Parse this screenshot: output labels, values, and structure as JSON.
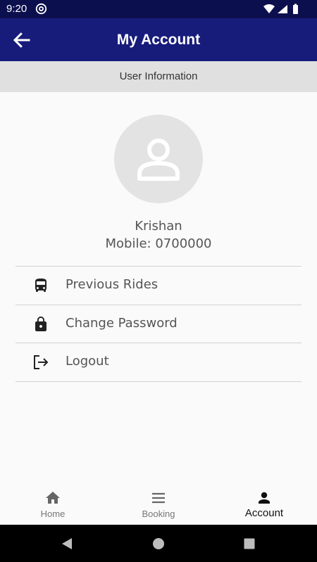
{
  "status_bar": {
    "time": "9:20",
    "app_icon": "at-sign-icon",
    "icons": [
      "wifi-icon",
      "signal-icon",
      "battery-icon"
    ]
  },
  "app_bar": {
    "title": "My Account",
    "back_icon": "arrow-left-icon",
    "background": "#171c7b"
  },
  "section_header": {
    "title": "User Information"
  },
  "user": {
    "avatar_icon": "person-icon",
    "name": "Krishan",
    "mobile": "Mobile: 0700000"
  },
  "menu": {
    "items": [
      {
        "label": "Previous Rides",
        "icon": "bus-icon"
      },
      {
        "label": "Change Password",
        "icon": "lock-icon"
      },
      {
        "label": "Logout",
        "icon": "logout-icon"
      }
    ]
  },
  "bottom_nav": {
    "items": [
      {
        "label": "Home",
        "icon": "home-icon",
        "active": false
      },
      {
        "label": "Booking",
        "icon": "menu-icon",
        "active": false
      },
      {
        "label": "Account",
        "icon": "person-icon",
        "active": true
      }
    ]
  },
  "system_nav": {
    "icons": [
      "back-triangle-icon",
      "home-circle-icon",
      "recents-square-icon"
    ]
  }
}
